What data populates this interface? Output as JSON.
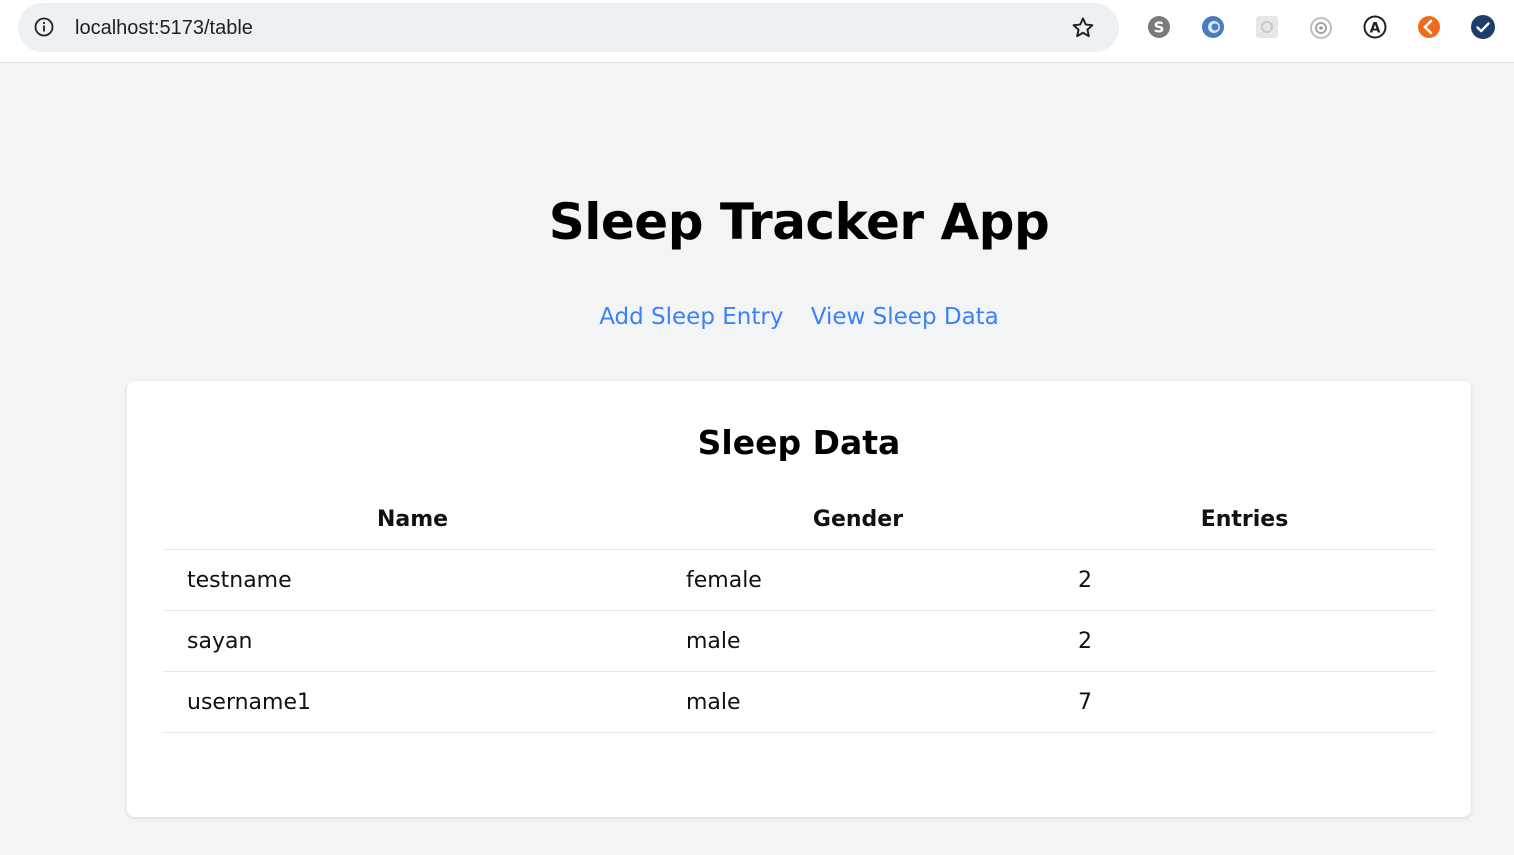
{
  "browser": {
    "url": "localhost:5173/table",
    "extensions": [
      "skype-icon",
      "edge-blue-icon",
      "grey-square-icon",
      "target-icon",
      "a-circle-icon",
      "orange-extension-icon",
      "check-circle-icon"
    ],
    "accent_colors": {
      "link": "#3b82f6",
      "page_bg": "#f3f4f6",
      "card_bg": "#ffffff"
    }
  },
  "app": {
    "title": "Sleep Tracker App",
    "nav": {
      "add_entry": "Add Sleep Entry",
      "view_data": "View Sleep Data"
    }
  },
  "card": {
    "title": "Sleep Data",
    "headers": {
      "name": "Name",
      "gender": "Gender",
      "entries": "Entries"
    },
    "rows": [
      {
        "name": "testname",
        "gender": "female",
        "entries": "2"
      },
      {
        "name": "sayan",
        "gender": "male",
        "entries": "2"
      },
      {
        "name": "username1",
        "gender": "male",
        "entries": "7"
      }
    ]
  }
}
